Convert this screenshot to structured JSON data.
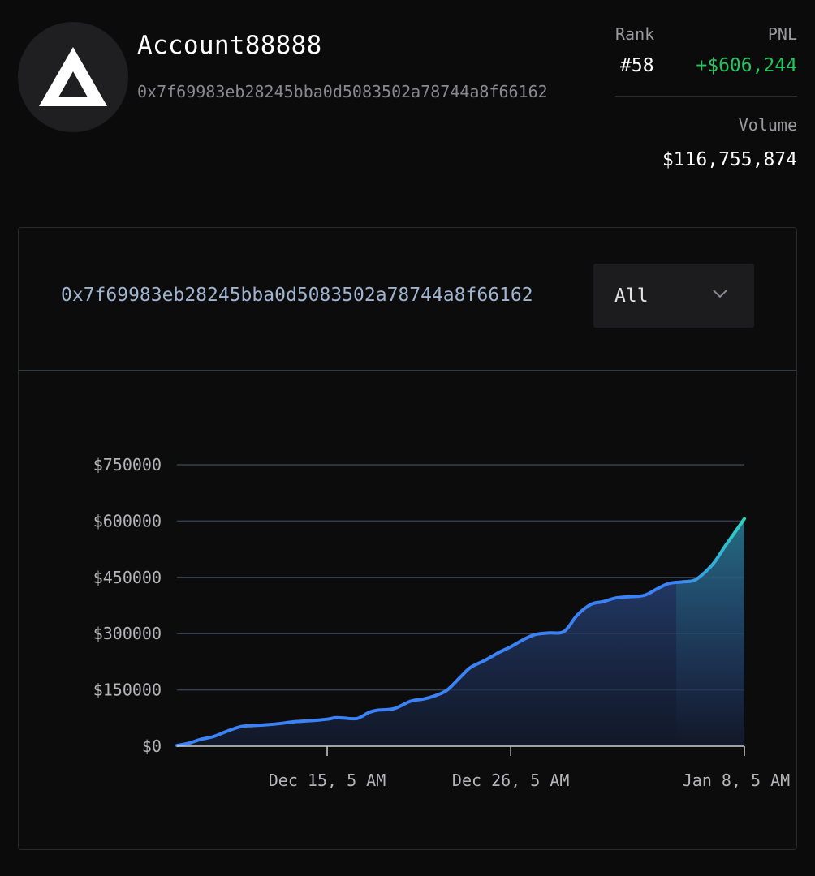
{
  "account": {
    "name": "Account88888",
    "address": "0x7f69983eb28245bba0d5083502a78744a8f66162",
    "avatar_icon": "white-triangle-logo-icon"
  },
  "stats": {
    "rank_label": "Rank",
    "rank_value": "#58",
    "pnl_label": "PNL",
    "pnl_value": "+$606,244",
    "volume_label": "Volume",
    "volume_value": "$116,755,874"
  },
  "card": {
    "address": "0x7f69983eb28245bba0d5083502a78744a8f66162",
    "range_select": {
      "value": "All",
      "icon": "chevron-down-icon"
    }
  },
  "colors": {
    "pnl_positive": "#22c55e",
    "line_start": "#3b82f6",
    "line_end": "#2dd4bf"
  },
  "chart_data": {
    "type": "area",
    "title": "",
    "xlabel": "",
    "ylabel": "",
    "grid": true,
    "ylim": [
      0,
      750000
    ],
    "y_ticks": [
      "$0",
      "$150000",
      "$300000",
      "$450000",
      "$600000",
      "$750000"
    ],
    "x_ticks": [
      "Dec 15, 5 AM",
      "Dec 26, 5 AM",
      "Jan 8, 5 AM"
    ],
    "x_tick_days": [
      9,
      20,
      34
    ],
    "x_range_days": [
      0,
      34
    ],
    "series": [
      {
        "x": [
          0,
          0.7,
          1.4,
          2.2,
          3,
          3.8,
          4.5,
          5.3,
          6.1,
          7,
          8,
          9,
          9.5,
          10,
          10.8,
          11.5,
          12,
          13,
          14,
          14.8,
          15.5,
          16.2,
          17,
          17.6,
          18.5,
          19.3,
          20,
          20.8,
          21.5,
          22.3,
          23.2,
          24,
          24.8,
          25.5,
          26.3,
          27,
          28,
          28.8,
          29.5,
          30.3,
          31,
          31.6,
          32.2,
          32.8,
          33.4,
          34
        ],
        "y": [
          2000,
          8000,
          18000,
          26000,
          40000,
          52000,
          55000,
          57000,
          60000,
          65000,
          68000,
          72000,
          76000,
          75000,
          74000,
          90000,
          96000,
          100000,
          120000,
          126000,
          135000,
          150000,
          185000,
          210000,
          230000,
          250000,
          265000,
          285000,
          298000,
          302000,
          306000,
          350000,
          378000,
          385000,
          395000,
          398000,
          402000,
          420000,
          434000,
          438000,
          442000,
          462000,
          490000,
          530000,
          568000,
          606244
        ]
      }
    ]
  }
}
